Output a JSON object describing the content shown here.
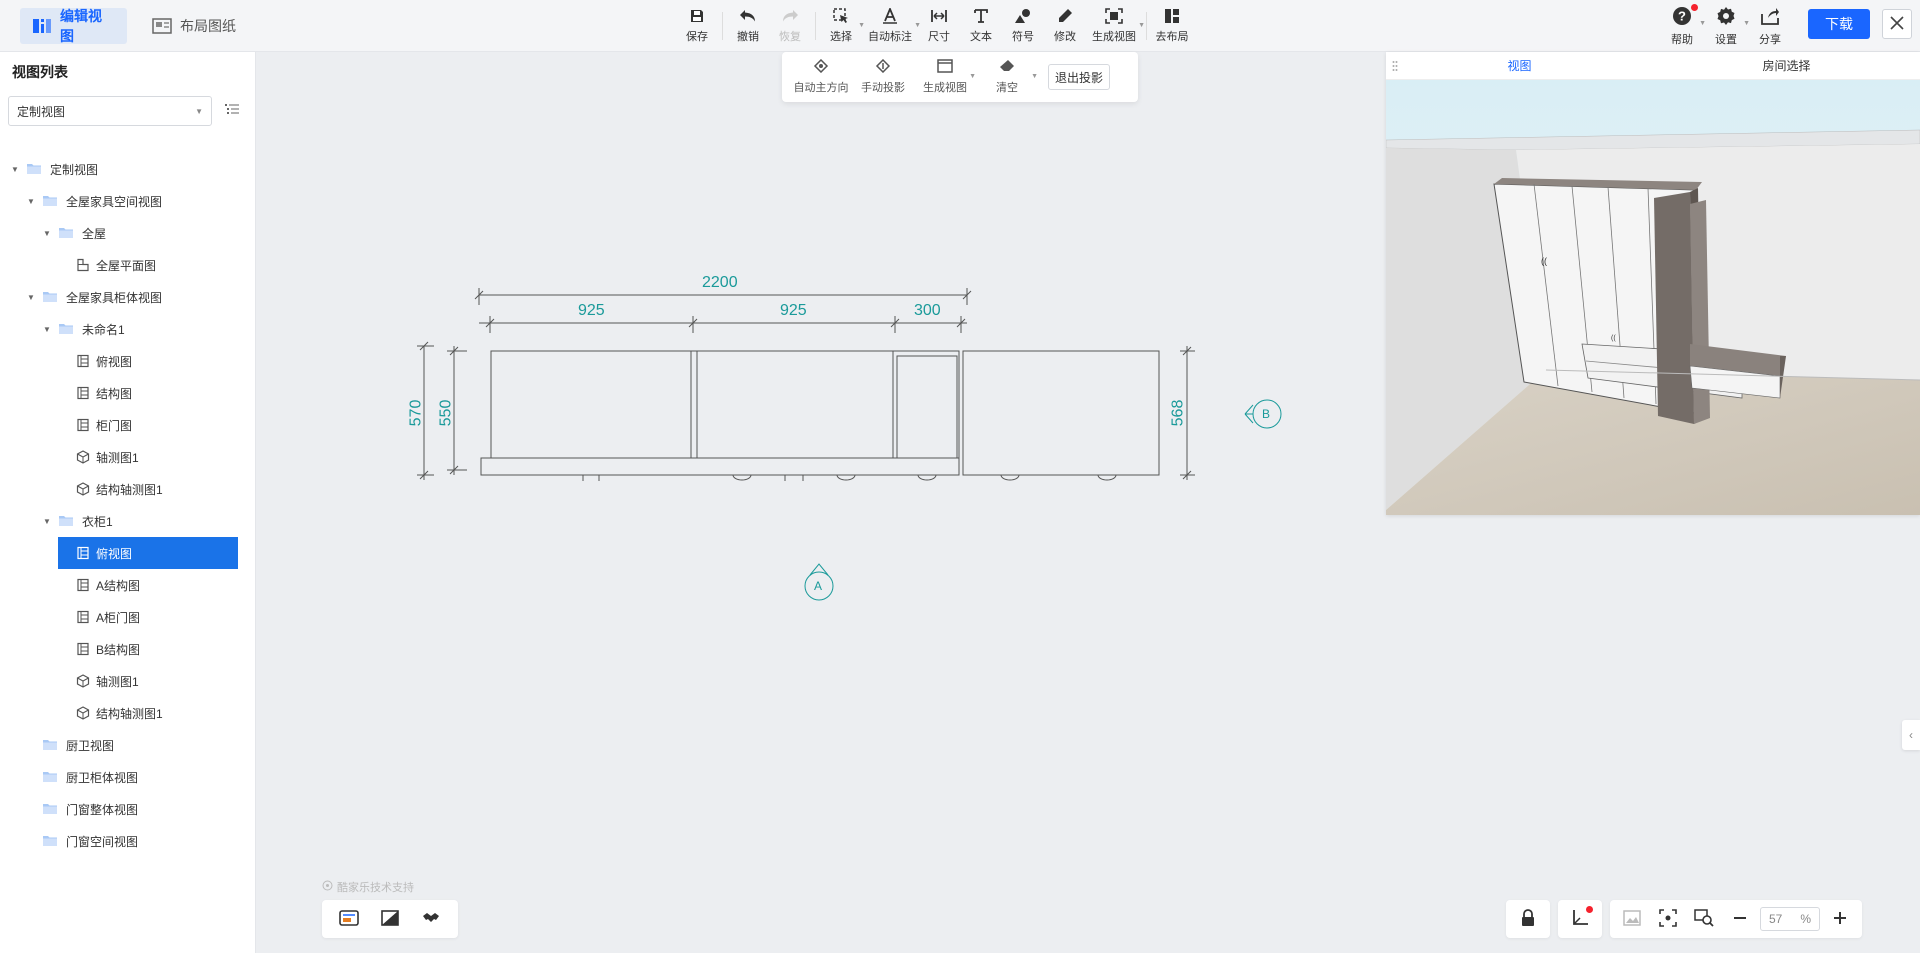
{
  "topbar": {
    "tab_edit": "编辑视图",
    "tab_layout": "布局图纸",
    "tools": {
      "save": "保存",
      "undo": "撤销",
      "redo": "恢复",
      "select": "选择",
      "auto_annotate": "自动标注",
      "dimension": "尺寸",
      "text": "文本",
      "symbol": "符号",
      "modify": "修改",
      "generate_view": "生成视图",
      "to_layout": "去布局"
    },
    "help": "帮助",
    "settings": "设置",
    "share": "分享",
    "download": "下载"
  },
  "subbar": {
    "auto_direction": "自动主方向",
    "manual_projection": "手动投影",
    "generate_view": "生成视图",
    "clear": "清空",
    "exit_projection": "退出投影"
  },
  "left_panel": {
    "title": "视图列表",
    "selected_view": "定制视图",
    "tree": [
      {
        "label": "定制视图",
        "type": "folder",
        "level": 0,
        "expanded": true
      },
      {
        "label": "全屋家具空间视图",
        "type": "folder",
        "level": 1,
        "expanded": true
      },
      {
        "label": "全屋",
        "type": "folder",
        "level": 2,
        "expanded": true
      },
      {
        "label": "全屋平面图",
        "type": "plan",
        "level": 3
      },
      {
        "label": "全屋家具柜体视图",
        "type": "folder",
        "level": 1,
        "expanded": true
      },
      {
        "label": "未命名1",
        "type": "folder",
        "level": 2,
        "expanded": true
      },
      {
        "label": "俯视图",
        "type": "view",
        "level": 3
      },
      {
        "label": "结构图",
        "type": "view",
        "level": 3
      },
      {
        "label": "柜门图",
        "type": "view",
        "level": 3
      },
      {
        "label": "轴测图1",
        "type": "iso",
        "level": 3
      },
      {
        "label": "结构轴测图1",
        "type": "iso",
        "level": 3
      },
      {
        "label": "衣柜1",
        "type": "folder",
        "level": 2,
        "expanded": true
      },
      {
        "label": "俯视图",
        "type": "view",
        "level": 3,
        "selected": true
      },
      {
        "label": "A结构图",
        "type": "view",
        "level": 3
      },
      {
        "label": "A柜门图",
        "type": "view",
        "level": 3
      },
      {
        "label": "B结构图",
        "type": "view",
        "level": 3
      },
      {
        "label": "轴测图1",
        "type": "iso",
        "level": 3
      },
      {
        "label": "结构轴测图1",
        "type": "iso",
        "level": 3
      },
      {
        "label": "厨卫视图",
        "type": "folder",
        "level": 1
      },
      {
        "label": "厨卫柜体视图",
        "type": "folder",
        "level": 1
      },
      {
        "label": "门窗整体视图",
        "type": "folder",
        "level": 1
      },
      {
        "label": "门窗空间视图",
        "type": "folder",
        "level": 1
      }
    ]
  },
  "drawing": {
    "dim_total": "2200",
    "dim_a": "925",
    "dim_b": "925",
    "dim_c": "300",
    "dim_left_outer": "570",
    "dim_left_inner": "550",
    "dim_right": "568",
    "marker_a": "A",
    "marker_b": "B"
  },
  "panel3d": {
    "tab_view": "视图",
    "tab_room": "房间选择"
  },
  "watermark": "酷家乐技术支持",
  "zoom": {
    "value": "57",
    "unit": "%"
  },
  "colors": {
    "accent": "#1a66ff",
    "dimension": "#1a9a9a",
    "selected": "#1a73e8"
  }
}
